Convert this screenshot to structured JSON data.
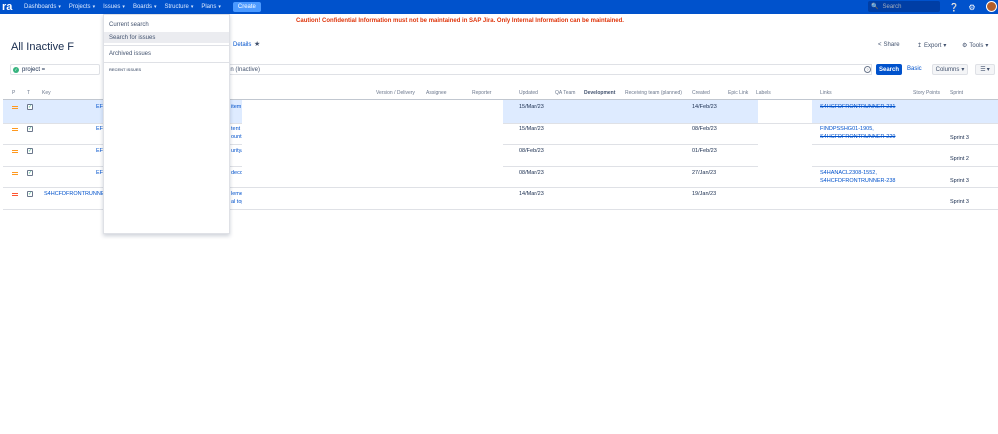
{
  "topnav": {
    "logo": "ra",
    "items": [
      {
        "label": "Dashboards"
      },
      {
        "label": "Projects"
      },
      {
        "label": "Issues"
      },
      {
        "label": "Boards"
      },
      {
        "label": "Structure"
      },
      {
        "label": "Plans"
      }
    ],
    "create_label": "Create",
    "search_placeholder": "Search"
  },
  "banner": "Caution! Confidential Information must not be maintained in SAP Jira. Only Internal Information can be maintained.",
  "page": {
    "title": "All Inactive F",
    "details_label": "Details",
    "share_label": "Share",
    "export_label": "Export",
    "tools_label": "Tools"
  },
  "filter": {
    "project_chip": "project =",
    "jql_tail": "in (Inactive)",
    "search_label": "Search",
    "basic_label": "Basic",
    "columns_label": "Columns"
  },
  "dropdown": {
    "items": [
      "Current search",
      "Search for issues",
      "Archived issues"
    ],
    "recent_heading": "RECENT ISSUES"
  },
  "table": {
    "headers": [
      "P",
      "T",
      "Key",
      "Version / Delivery",
      "Assignee",
      "Reporter",
      "Updated",
      "QA Team",
      "Development",
      "Receiving team (planned)",
      "Created",
      "Epic Link",
      "Labels",
      "Links",
      "Story Points",
      "Sprint"
    ],
    "rows": [
      {
        "key": "EF",
        "summary": "item",
        "updated": "15/Mar/23",
        "created": "14/Feb/23",
        "links": [
          "S4HCFDFRONTRUNNER-231"
        ],
        "sprint": ""
      },
      {
        "key": "EF",
        "summary": "tent",
        "summary2": "ountr",
        "updated": "15/Mar/23",
        "created": "08/Feb/23",
        "links": [
          "FINDPSSHG01-1905,",
          "S4HCFDFRONTRUNNER-229"
        ],
        "sprint": "Sprint 3"
      },
      {
        "key": "EF",
        "summary": "urity/",
        "updated": "08/Feb/23",
        "created": "01/Feb/23",
        "links": [],
        "sprint": "Sprint 2"
      },
      {
        "key": "EF",
        "summary": "decor",
        "updated": "08/Mar/23",
        "created": "27/Jan/23",
        "links": [
          "S4HANACL2308-1552,",
          "S4HCFDFRONTRUNNER-238"
        ],
        "sprint": "Sprint 3"
      },
      {
        "key": "S4HCFDFRONTRUNNER",
        "summary": "leme",
        "summary2": "al top",
        "updated": "14/Mar/23",
        "created": "19/Jan/23",
        "links": [],
        "sprint": "Sprint 3"
      }
    ]
  }
}
